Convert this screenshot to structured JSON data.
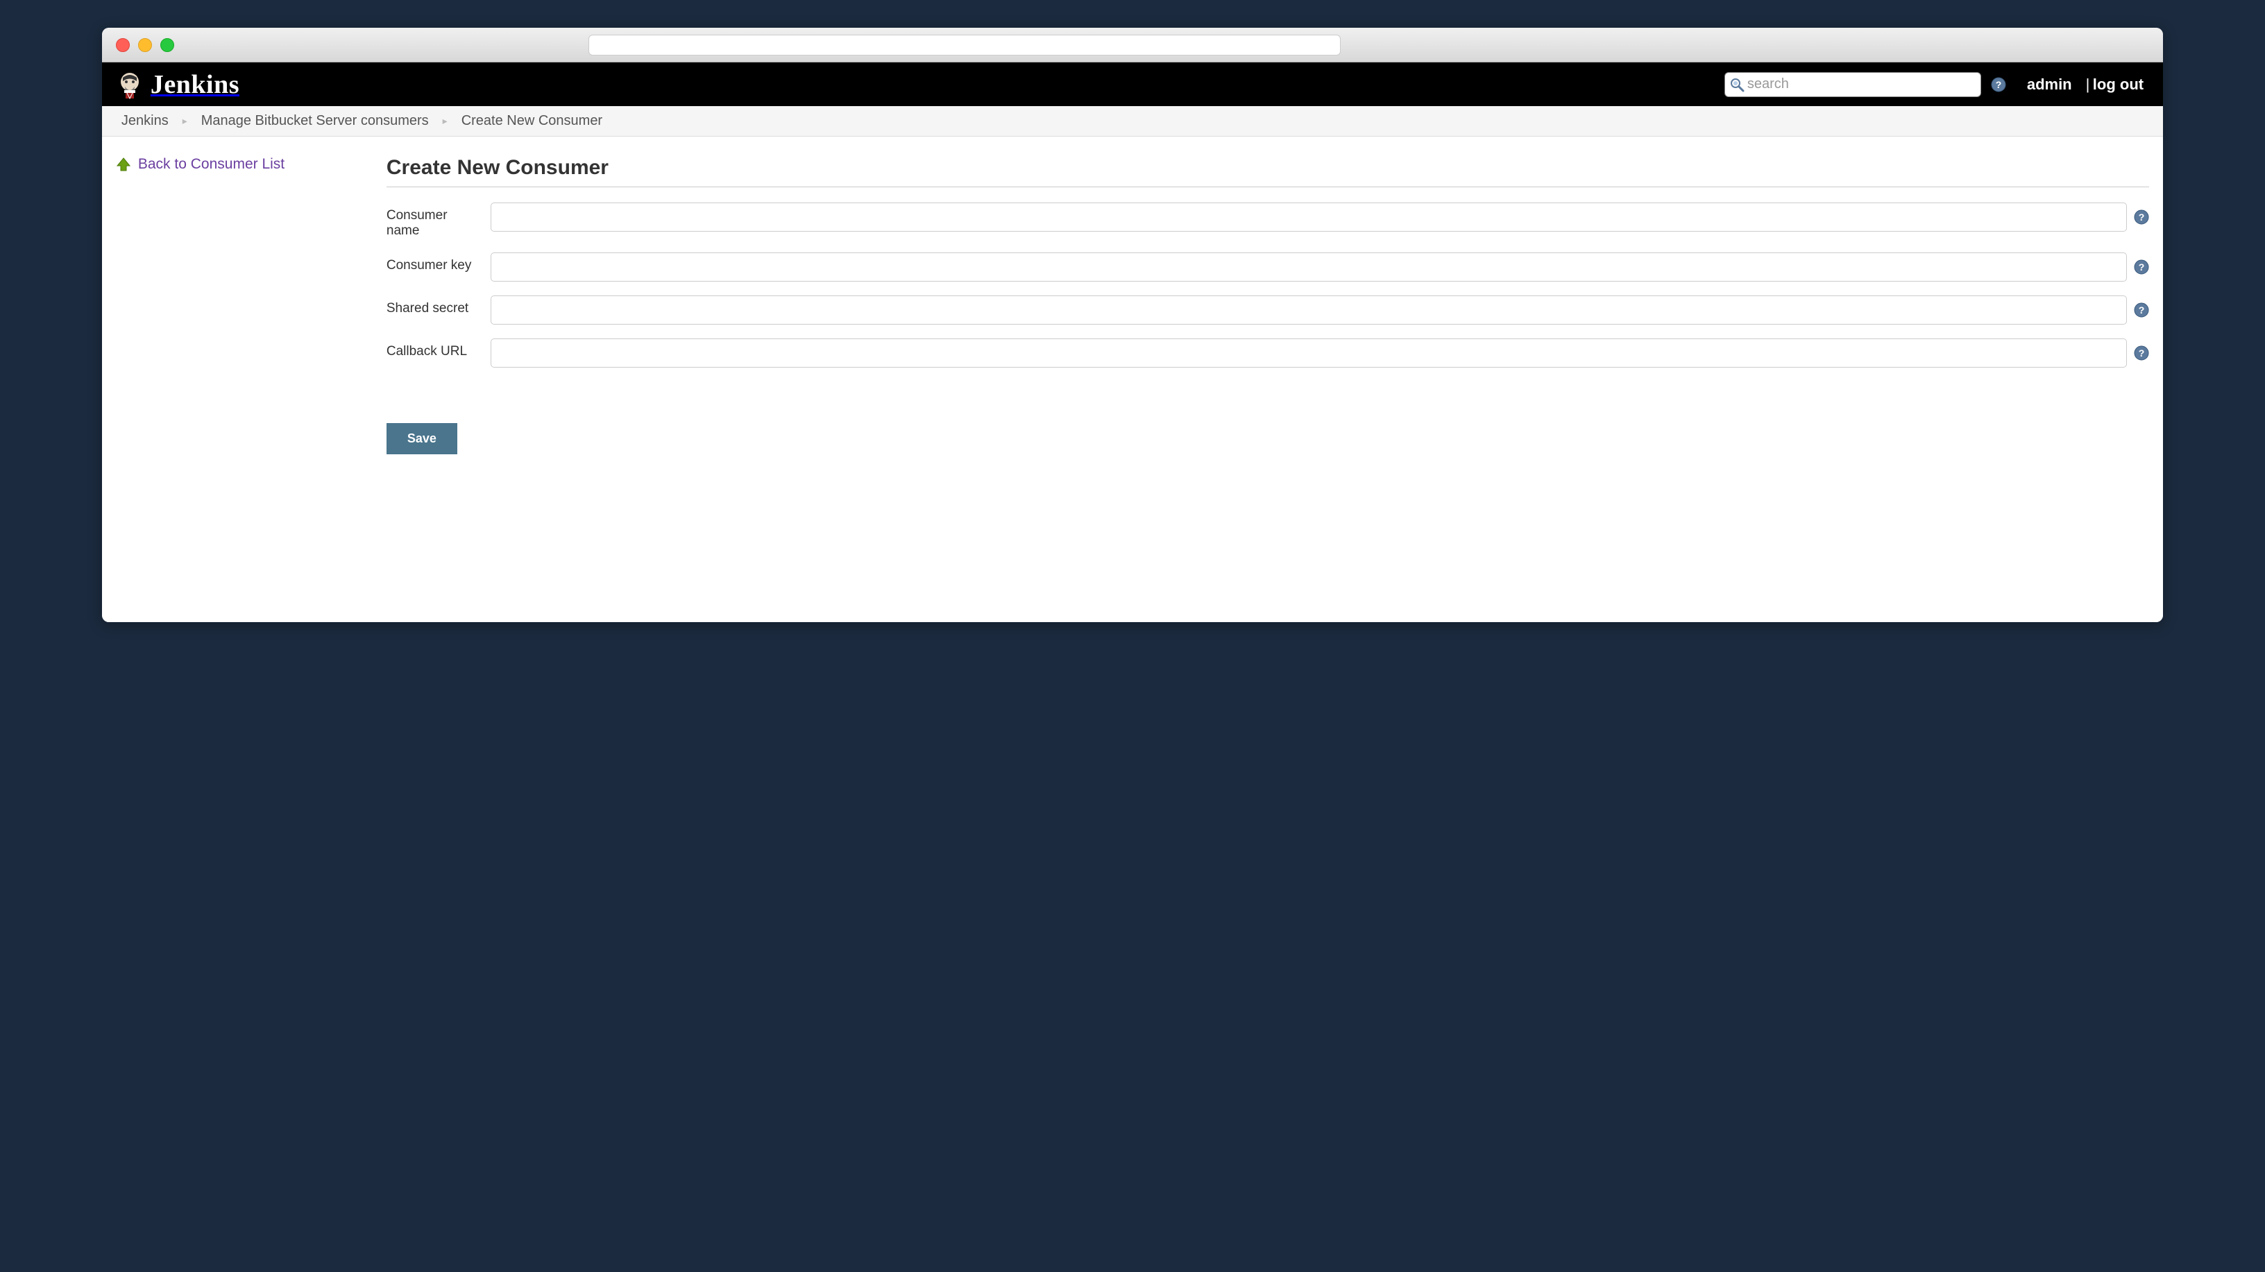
{
  "header": {
    "logo_text": "Jenkins",
    "search_placeholder": "search",
    "user_label": "admin",
    "logout_label": "log out",
    "separator": "|"
  },
  "breadcrumb": {
    "items": [
      "Jenkins",
      "Manage Bitbucket Server consumers",
      "Create New Consumer"
    ]
  },
  "sidebar": {
    "back_link": "Back to Consumer List"
  },
  "form": {
    "title": "Create New Consumer",
    "fields": [
      {
        "label": "Consumer name",
        "value": ""
      },
      {
        "label": "Consumer key",
        "value": ""
      },
      {
        "label": "Shared secret",
        "value": ""
      },
      {
        "label": "Callback URL",
        "value": ""
      }
    ],
    "save_label": "Save"
  }
}
